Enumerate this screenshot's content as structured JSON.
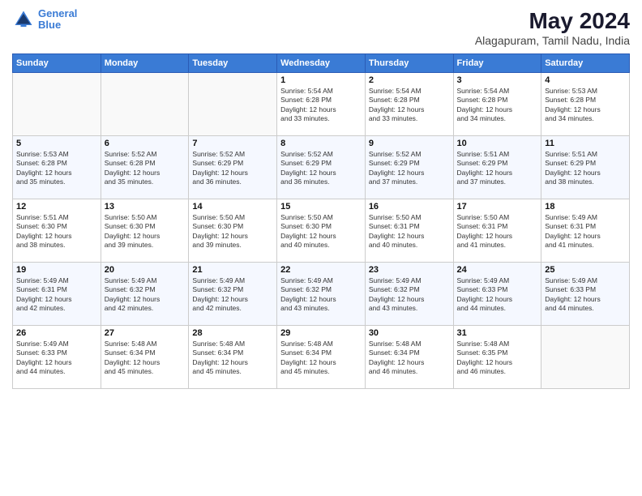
{
  "logo": {
    "line1": "General",
    "line2": "Blue"
  },
  "title": "May 2024",
  "subtitle": "Alagapuram, Tamil Nadu, India",
  "days_header": [
    "Sunday",
    "Monday",
    "Tuesday",
    "Wednesday",
    "Thursday",
    "Friday",
    "Saturday"
  ],
  "weeks": [
    [
      {
        "num": "",
        "info": ""
      },
      {
        "num": "",
        "info": ""
      },
      {
        "num": "",
        "info": ""
      },
      {
        "num": "1",
        "info": "Sunrise: 5:54 AM\nSunset: 6:28 PM\nDaylight: 12 hours\nand 33 minutes."
      },
      {
        "num": "2",
        "info": "Sunrise: 5:54 AM\nSunset: 6:28 PM\nDaylight: 12 hours\nand 33 minutes."
      },
      {
        "num": "3",
        "info": "Sunrise: 5:54 AM\nSunset: 6:28 PM\nDaylight: 12 hours\nand 34 minutes."
      },
      {
        "num": "4",
        "info": "Sunrise: 5:53 AM\nSunset: 6:28 PM\nDaylight: 12 hours\nand 34 minutes."
      }
    ],
    [
      {
        "num": "5",
        "info": "Sunrise: 5:53 AM\nSunset: 6:28 PM\nDaylight: 12 hours\nand 35 minutes."
      },
      {
        "num": "6",
        "info": "Sunrise: 5:52 AM\nSunset: 6:28 PM\nDaylight: 12 hours\nand 35 minutes."
      },
      {
        "num": "7",
        "info": "Sunrise: 5:52 AM\nSunset: 6:29 PM\nDaylight: 12 hours\nand 36 minutes."
      },
      {
        "num": "8",
        "info": "Sunrise: 5:52 AM\nSunset: 6:29 PM\nDaylight: 12 hours\nand 36 minutes."
      },
      {
        "num": "9",
        "info": "Sunrise: 5:52 AM\nSunset: 6:29 PM\nDaylight: 12 hours\nand 37 minutes."
      },
      {
        "num": "10",
        "info": "Sunrise: 5:51 AM\nSunset: 6:29 PM\nDaylight: 12 hours\nand 37 minutes."
      },
      {
        "num": "11",
        "info": "Sunrise: 5:51 AM\nSunset: 6:29 PM\nDaylight: 12 hours\nand 38 minutes."
      }
    ],
    [
      {
        "num": "12",
        "info": "Sunrise: 5:51 AM\nSunset: 6:30 PM\nDaylight: 12 hours\nand 38 minutes."
      },
      {
        "num": "13",
        "info": "Sunrise: 5:50 AM\nSunset: 6:30 PM\nDaylight: 12 hours\nand 39 minutes."
      },
      {
        "num": "14",
        "info": "Sunrise: 5:50 AM\nSunset: 6:30 PM\nDaylight: 12 hours\nand 39 minutes."
      },
      {
        "num": "15",
        "info": "Sunrise: 5:50 AM\nSunset: 6:30 PM\nDaylight: 12 hours\nand 40 minutes."
      },
      {
        "num": "16",
        "info": "Sunrise: 5:50 AM\nSunset: 6:31 PM\nDaylight: 12 hours\nand 40 minutes."
      },
      {
        "num": "17",
        "info": "Sunrise: 5:50 AM\nSunset: 6:31 PM\nDaylight: 12 hours\nand 41 minutes."
      },
      {
        "num": "18",
        "info": "Sunrise: 5:49 AM\nSunset: 6:31 PM\nDaylight: 12 hours\nand 41 minutes."
      }
    ],
    [
      {
        "num": "19",
        "info": "Sunrise: 5:49 AM\nSunset: 6:31 PM\nDaylight: 12 hours\nand 42 minutes."
      },
      {
        "num": "20",
        "info": "Sunrise: 5:49 AM\nSunset: 6:32 PM\nDaylight: 12 hours\nand 42 minutes."
      },
      {
        "num": "21",
        "info": "Sunrise: 5:49 AM\nSunset: 6:32 PM\nDaylight: 12 hours\nand 42 minutes."
      },
      {
        "num": "22",
        "info": "Sunrise: 5:49 AM\nSunset: 6:32 PM\nDaylight: 12 hours\nand 43 minutes."
      },
      {
        "num": "23",
        "info": "Sunrise: 5:49 AM\nSunset: 6:32 PM\nDaylight: 12 hours\nand 43 minutes."
      },
      {
        "num": "24",
        "info": "Sunrise: 5:49 AM\nSunset: 6:33 PM\nDaylight: 12 hours\nand 44 minutes."
      },
      {
        "num": "25",
        "info": "Sunrise: 5:49 AM\nSunset: 6:33 PM\nDaylight: 12 hours\nand 44 minutes."
      }
    ],
    [
      {
        "num": "26",
        "info": "Sunrise: 5:49 AM\nSunset: 6:33 PM\nDaylight: 12 hours\nand 44 minutes."
      },
      {
        "num": "27",
        "info": "Sunrise: 5:48 AM\nSunset: 6:34 PM\nDaylight: 12 hours\nand 45 minutes."
      },
      {
        "num": "28",
        "info": "Sunrise: 5:48 AM\nSunset: 6:34 PM\nDaylight: 12 hours\nand 45 minutes."
      },
      {
        "num": "29",
        "info": "Sunrise: 5:48 AM\nSunset: 6:34 PM\nDaylight: 12 hours\nand 45 minutes."
      },
      {
        "num": "30",
        "info": "Sunrise: 5:48 AM\nSunset: 6:34 PM\nDaylight: 12 hours\nand 46 minutes."
      },
      {
        "num": "31",
        "info": "Sunrise: 5:48 AM\nSunset: 6:35 PM\nDaylight: 12 hours\nand 46 minutes."
      },
      {
        "num": "",
        "info": ""
      }
    ]
  ]
}
